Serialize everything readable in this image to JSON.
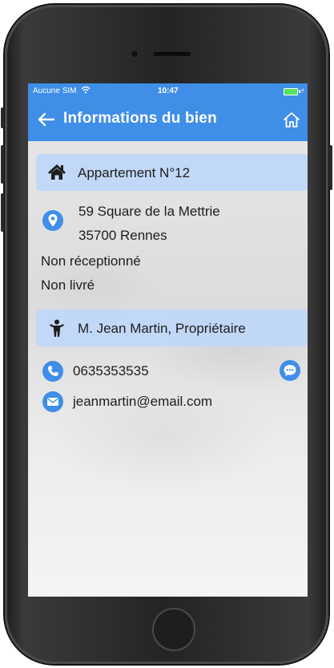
{
  "status_bar": {
    "carrier": "Aucune SIM",
    "time": "10:47"
  },
  "header": {
    "title": "Informations du bien"
  },
  "property": {
    "name": "Appartement N°12",
    "address_line1": "59 Square de la Mettrie",
    "address_line2": "35700 Rennes",
    "reception_status": "Non réceptionné",
    "delivery_status": "Non livré"
  },
  "owner": {
    "name": "M. Jean Martin, Propriétaire",
    "phone": "0635353535",
    "email": "jeanmartin@email.com"
  },
  "colors": {
    "accent": "#3f8ee8",
    "card_background": "#bed7f8",
    "battery": "#50e35f"
  },
  "icons": {
    "back": "arrow-left-icon",
    "home": "home-outline-icon",
    "property": "house-icon",
    "location": "map-pin-icon",
    "owner": "person-icon",
    "phone": "phone-icon",
    "message": "chat-bubble-icon",
    "email": "envelope-icon"
  }
}
